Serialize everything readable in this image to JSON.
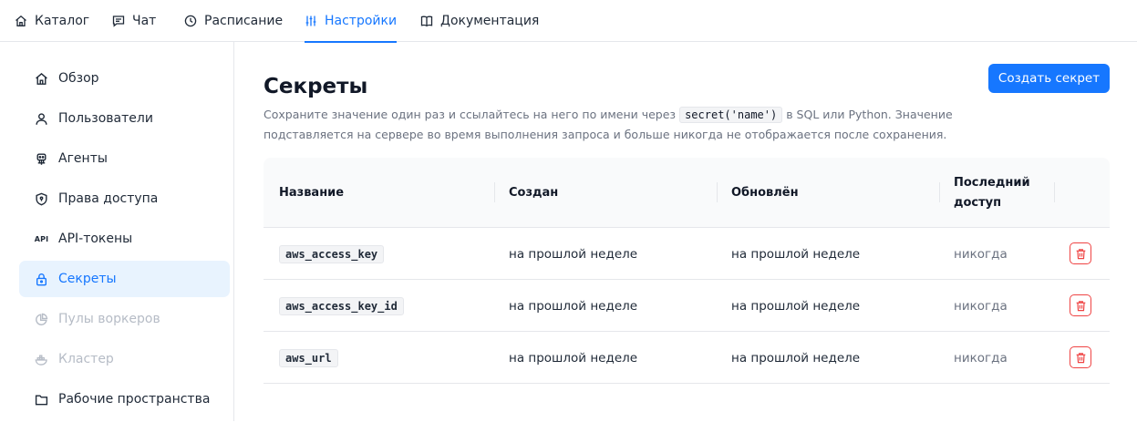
{
  "topnav": {
    "tabs": [
      {
        "label": "Каталог",
        "icon": "home-icon"
      },
      {
        "label": "Чат",
        "icon": "chat-icon"
      },
      {
        "label": "Расписание",
        "icon": "clock-icon"
      },
      {
        "label": "Настройки",
        "icon": "sliders-icon",
        "active": true
      },
      {
        "label": "Документация",
        "icon": "book-icon"
      }
    ]
  },
  "sidebar": {
    "items": [
      {
        "label": "Обзор",
        "icon": "home-icon"
      },
      {
        "label": "Пользователи",
        "icon": "user-icon"
      },
      {
        "label": "Агенты",
        "icon": "robot-icon"
      },
      {
        "label": "Права доступа",
        "icon": "shield-icon"
      },
      {
        "label": "API-токены",
        "icon": "api-icon",
        "icon_text": "API"
      },
      {
        "label": "Секреты",
        "icon": "lock-icon",
        "active": true
      },
      {
        "label": "Пулы воркеров",
        "icon": "pie-chart-icon",
        "disabled": true
      },
      {
        "label": "Кластер",
        "icon": "docker-icon",
        "disabled": true
      },
      {
        "label": "Рабочие пространства",
        "icon": "folder-icon"
      }
    ]
  },
  "main": {
    "title": "Секреты",
    "description_pre": "Сохраните значение один раз и ссылайтесь на него по имени через",
    "description_code": "secret('name')",
    "description_post": "в SQL или Python. Значение подставляется на сервере во время выполнения запроса и больше никогда не отображается после сохранения.",
    "create_button": "Создать секрет"
  },
  "table": {
    "headers": {
      "name": "Название",
      "created": "Создан",
      "updated": "Обновлён",
      "last_access_1": "Последний",
      "last_access_2": "доступ"
    },
    "rows": [
      {
        "name": "aws_access_key",
        "created": "на прошлой неделе",
        "updated": "на прошлой неделе",
        "last_access": "никогда"
      },
      {
        "name": "aws_access_key_id",
        "created": "на прошлой неделе",
        "updated": "на прошлой неделе",
        "last_access": "никогда"
      },
      {
        "name": "aws_url",
        "created": "на прошлой неделе",
        "updated": "на прошлой неделе",
        "last_access": "никогда"
      }
    ]
  },
  "colors": {
    "accent": "#1677ff",
    "active_bg": "#e8f3fe",
    "danger": "#ef4444",
    "muted_text": "#6b7280"
  }
}
